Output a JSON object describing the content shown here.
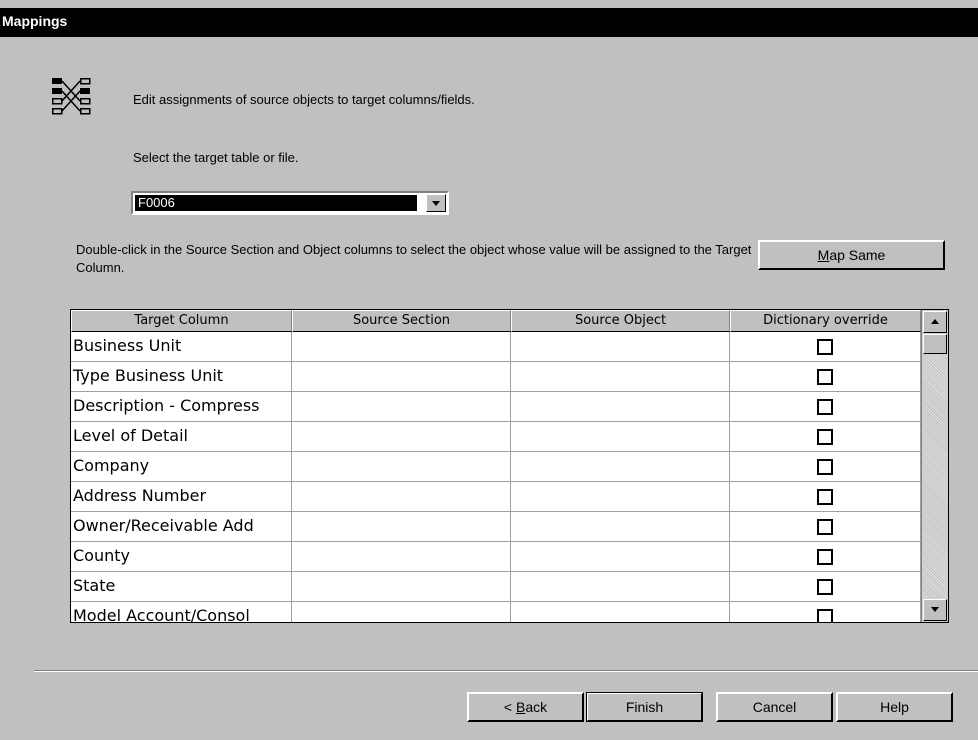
{
  "window": {
    "title": "Mappings"
  },
  "header": {
    "icon": "mapping-wizard-icon",
    "instruction": "Edit assignments of source objects to target columns/fields."
  },
  "target": {
    "label": "Select the target table or file.",
    "selected": "F0006"
  },
  "hint": "Double-click in the Source Section and Object columns to select the object whose value will be assigned to the Target Column.",
  "map_same": {
    "pre": "",
    "key": "M",
    "post": "ap Same"
  },
  "grid": {
    "columns": [
      "Target Column",
      "Source Section",
      "Source Object",
      "Dictionary override"
    ],
    "rows": [
      {
        "target": "Business Unit",
        "section": "",
        "object": "",
        "override": false
      },
      {
        "target": "Type Business Unit",
        "section": "",
        "object": "",
        "override": false
      },
      {
        "target": "Description - Compress",
        "section": "",
        "object": "",
        "override": false
      },
      {
        "target": "Level of Detail",
        "section": "",
        "object": "",
        "override": false
      },
      {
        "target": "Company",
        "section": "",
        "object": "",
        "override": false
      },
      {
        "target": "Address Number",
        "section": "",
        "object": "",
        "override": false
      },
      {
        "target": "Owner/Receivable Add",
        "section": "",
        "object": "",
        "override": false
      },
      {
        "target": "County",
        "section": "",
        "object": "",
        "override": false
      },
      {
        "target": "State",
        "section": "",
        "object": "",
        "override": false
      },
      {
        "target": "Model Account/Consol",
        "section": "",
        "object": "",
        "override": false
      }
    ]
  },
  "footer": {
    "back": {
      "pre": "< ",
      "key": "B",
      "post": "ack"
    },
    "finish": "Finish",
    "cancel": "Cancel",
    "help": "Help"
  }
}
